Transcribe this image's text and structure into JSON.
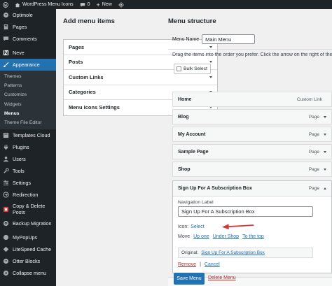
{
  "adminbar": {
    "site_name": "WordPress Menu Icons",
    "comments_count": "0",
    "new_label": "New"
  },
  "sidebar": {
    "items": [
      {
        "label": "Optimole",
        "icon": "optimole-icon"
      },
      {
        "label": "Pages",
        "icon": "pages-icon"
      },
      {
        "label": "Comments",
        "icon": "comments-icon"
      },
      {
        "label": "Neve",
        "icon": "neve-icon"
      },
      {
        "label": "Appearance",
        "icon": "appearance-icon"
      }
    ],
    "appearance_sub": [
      "Themes",
      "Patterns",
      "Customize",
      "Widgets",
      "Menus",
      "Theme File Editor"
    ],
    "items2": [
      {
        "label": "Templates Cloud",
        "icon": "templates-cloud-icon"
      },
      {
        "label": "Plugins",
        "icon": "plugins-icon"
      },
      {
        "label": "Users",
        "icon": "users-icon"
      },
      {
        "label": "Tools",
        "icon": "tools-icon"
      },
      {
        "label": "Settings",
        "icon": "settings-icon"
      },
      {
        "label": "Redirection",
        "icon": "redirection-icon"
      },
      {
        "label": "Copy & Delete Posts",
        "icon": "copy-delete-icon"
      },
      {
        "label": "Backup Migration",
        "icon": "backup-icon"
      },
      {
        "label": "MyPopUps",
        "icon": "mypopups-icon"
      },
      {
        "label": "LiteSpeed Cache",
        "icon": "litespeed-icon"
      },
      {
        "label": "Otter Blocks",
        "icon": "otter-icon"
      },
      {
        "label": "Collapse menu",
        "icon": "collapse-icon"
      }
    ]
  },
  "add_menu_items": {
    "title": "Add menu items",
    "sections": [
      "Pages",
      "Posts",
      "Custom Links",
      "Categories",
      "Menu Icons Settings"
    ]
  },
  "menu_structure": {
    "title": "Menu structure",
    "menu_name_label": "Menu Name",
    "menu_name_value": "Main Menu",
    "instructions": "Drag the items into the order you prefer. Click the arrow on the right of the ite",
    "bulk_select": "Bulk Select",
    "items": [
      {
        "title": "Home",
        "type": "Custom Link"
      },
      {
        "title": "Blog",
        "type": "Page"
      },
      {
        "title": "My Account",
        "type": "Page"
      },
      {
        "title": "Sample Page",
        "type": "Page"
      },
      {
        "title": "Shop",
        "type": "Page"
      }
    ],
    "expanded": {
      "title": "Sign Up For A Subscription Box",
      "type": "Page",
      "nav_label_caption": "Navigation Label",
      "nav_label_value": "Sign Up For A Subscription Box",
      "icon_label": "Icon:",
      "icon_select": "Select",
      "move_label": "Move",
      "move_up": "Up one",
      "move_under": "Under Shop",
      "move_top": "To the top",
      "original_label": "Original:",
      "original_link": "Sign Up For A Subscription Box",
      "remove": "Remove",
      "separator": "|",
      "cancel": "Cancel"
    },
    "save_button": "Save Menu",
    "delete_menu": "Delete Menu"
  },
  "colors": {
    "sidebar_bg": "#1d2327",
    "accent": "#2271b1",
    "arrow": "#d63638",
    "danger": "#b32d2e"
  }
}
